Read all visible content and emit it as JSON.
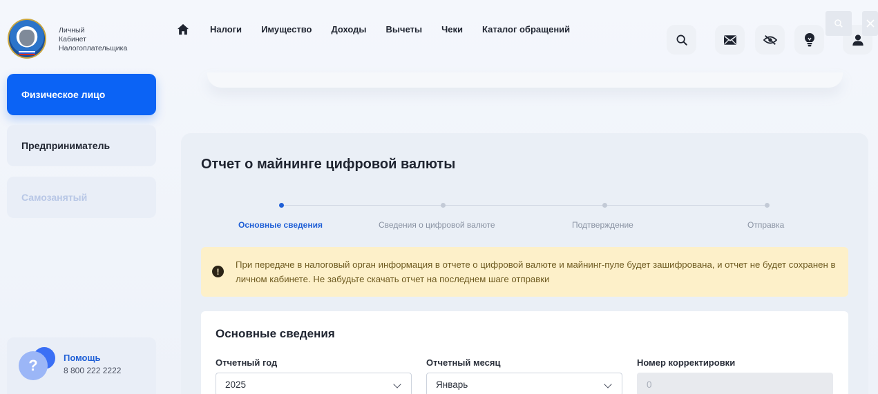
{
  "brand": {
    "line1": "Личный",
    "line2": "Кабинет",
    "line3": "Налогоплательщика"
  },
  "nav": {
    "items": [
      "Налоги",
      "Имущество",
      "Доходы",
      "Вычеты",
      "Чеки",
      "Каталог обращений"
    ]
  },
  "sidebar": {
    "items": [
      {
        "label": "Физическое лицо"
      },
      {
        "label": "Предприниматель"
      },
      {
        "label": "Самозанятый"
      }
    ],
    "help": {
      "title": "Помощь",
      "phone": "8 800 222 2222",
      "icon": "?"
    }
  },
  "page": {
    "title": "Отчет о майнинге цифровой валюты"
  },
  "stepper": {
    "steps": [
      "Основные сведения",
      "Сведения о цифровой валюте",
      "Подтверждение",
      "Отправка"
    ],
    "active_index": 0
  },
  "notice": {
    "icon": "!",
    "text": "При передаче в налоговый орган информация в отчете о цифровой валюте и майнинг-пуле будет зашифрована, и отчет не будет сохранен в личном кабинете. Не забудьте скачать отчет на последнем шаге отправки"
  },
  "form": {
    "section_title": "Основные сведения",
    "year": {
      "label": "Отчетный год",
      "value": "2025"
    },
    "month": {
      "label": "Отчетный месяц",
      "value": "Январь"
    },
    "correction": {
      "label": "Номер корректировки",
      "value": "0"
    }
  },
  "colors": {
    "accent": "#0b63f5",
    "notice_bg": "#fdf0c9",
    "active_step": "#1f5fd6"
  }
}
